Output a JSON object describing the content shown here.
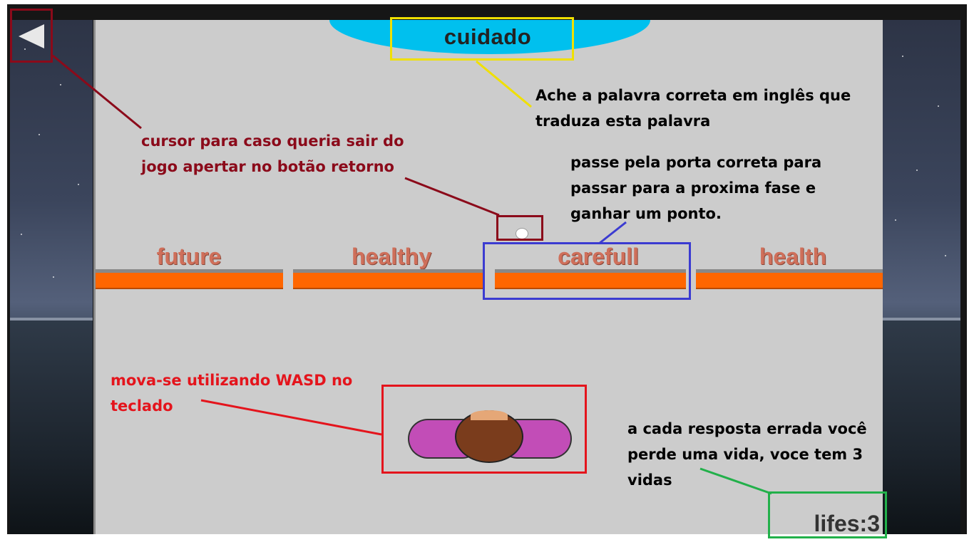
{
  "game": {
    "target_word": "cuidado",
    "doors": [
      {
        "label": "future"
      },
      {
        "label": "healthy"
      },
      {
        "label": "carefull"
      },
      {
        "label": "health"
      }
    ],
    "lives_text": "lifes:3",
    "sky_color": "#3b455c",
    "floor_color": "#cccccc",
    "door_color": "#ff6600",
    "cloud_color": "#00c0ee"
  },
  "controls": {
    "back_icon": "back-triangle-icon"
  },
  "annotations": {
    "back": {
      "lines": [
        "cursor para caso queria sair do",
        "jogo apertar no botão retorno"
      ],
      "color": "#8b0a1a"
    },
    "word": {
      "lines": [
        "Ache a palavra correta em inglês que",
        "traduza esta palavra"
      ],
      "color": "#000000",
      "box_color": "#f0e000"
    },
    "door": {
      "lines": [
        "passe pela porta correta para",
        "passar para a proxima fase e",
        "ganhar um ponto."
      ],
      "color": "#000000",
      "box_color": "#3b3bd1"
    },
    "move": {
      "lines": [
        "mova-se utilizando WASD no",
        "teclado"
      ],
      "color": "#e4141c"
    },
    "lives": {
      "lines": [
        "a cada resposta errada você",
        "perde uma vida, voce tem 3",
        "vidas"
      ],
      "color": "#000000",
      "box_color": "#22b04a"
    }
  }
}
